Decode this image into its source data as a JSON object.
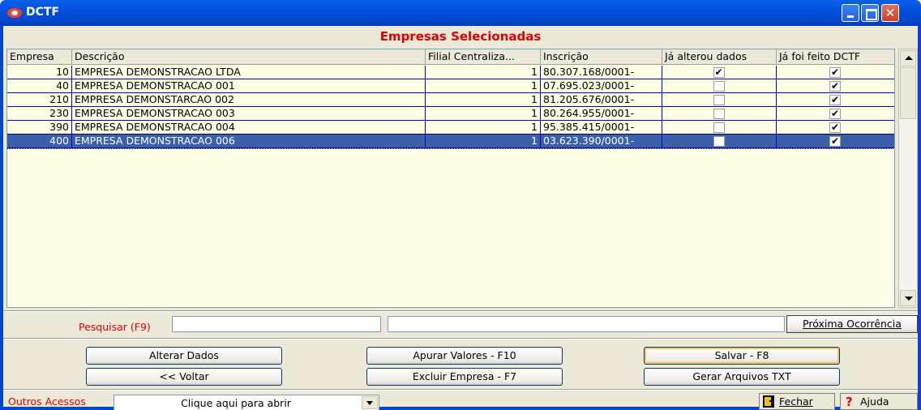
{
  "window": {
    "title": "DCTF"
  },
  "heading": "Empresas Selecionadas",
  "grid": {
    "columns": [
      "Empresa",
      "Descrição",
      "Filial Centraliza...",
      "Inscrição",
      "Já alterou dados",
      "Já foi feito DCTF"
    ],
    "rows": [
      {
        "empresa": "10",
        "descricao": "EMPRESA DEMONSTRACAO LTDA",
        "filial": "1",
        "inscricao": "80.307.168/0001-",
        "alterou": true,
        "dctf": true
      },
      {
        "empresa": "40",
        "descricao": "EMPRESA DEMONSTRACAO 001",
        "filial": "1",
        "inscricao": "07.695.023/0001-",
        "alterou": false,
        "dctf": true
      },
      {
        "empresa": "210",
        "descricao": "EMPRESA DEMONSTARCAO 002",
        "filial": "1",
        "inscricao": "81.205.676/0001-",
        "alterou": false,
        "dctf": true
      },
      {
        "empresa": "230",
        "descricao": "EMPRESA DEMONSTRACAO 003",
        "filial": "1",
        "inscricao": "80.264.955/0001-",
        "alterou": false,
        "dctf": true
      },
      {
        "empresa": "390",
        "descricao": "EMPRESA DEMONSTRACAO 004",
        "filial": "1",
        "inscricao": "95.385.415/0001-",
        "alterou": false,
        "dctf": true
      },
      {
        "empresa": "400",
        "descricao": "EMPRESA DEMONSTRACAO 006",
        "filial": "1",
        "inscricao": "03.623.390/0001-",
        "alterou": false,
        "dctf": true
      }
    ],
    "selected_row": 5
  },
  "search": {
    "label": "Pesquisar (F9)",
    "value1": "",
    "value2": "",
    "next_label": "Próxima Ocorrência"
  },
  "buttons": {
    "alterar": "Alterar Dados",
    "apurar": "Apurar Valores  - F10",
    "salvar": "Salvar - F8",
    "voltar": "<< Voltar",
    "excluir": "Excluir Empresa - F7",
    "gerar": "Gerar Arquivos TXT"
  },
  "footer": {
    "outros_label": "Outros Acessos",
    "combo_value": "Clique aqui para abrir",
    "fechar": "Fechar",
    "ajuda": "Ajuda"
  },
  "icons": {
    "app": "app-icon",
    "fechar": "exit-door-icon",
    "ajuda": "help-question-icon"
  },
  "colors": {
    "titlebar": "#0151DC",
    "heading": "#E00000",
    "selection": "#3B5FA8",
    "grid_bg": "#FFFFE6"
  }
}
